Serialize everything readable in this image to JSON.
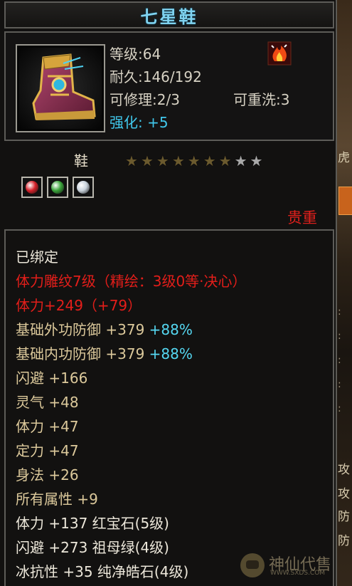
{
  "item": {
    "name": "七星鞋",
    "level": "等级:64",
    "durability": "耐久:146/192",
    "repair": "可修理:2/3",
    "rewash": "可重洗:3",
    "enhance_label": "强化:",
    "enhance_value": "+5",
    "type": "鞋",
    "quality": "贵重",
    "stars": {
      "filled": 7,
      "total": 9
    },
    "gems": [
      {
        "name": "ruby-gem",
        "color": "#d6212a"
      },
      {
        "name": "emerald-gem",
        "color": "#3aa33a"
      },
      {
        "name": "diamond-gem",
        "color": "#c9d3dc"
      }
    ]
  },
  "attributes": [
    {
      "text": "已绑定",
      "color": "white"
    },
    {
      "text": "体力雕纹7级（精绘：3级0等·决心）",
      "color": "red"
    },
    {
      "text": "体力+249（+79）",
      "color": "red"
    },
    {
      "text": "基础外功防御 +379 ",
      "pct": "+88%",
      "color": "yellow"
    },
    {
      "text": "基础内功防御 +379 ",
      "pct": "+88%",
      "color": "yellow"
    },
    {
      "text": "闪避 +166",
      "color": "yellow"
    },
    {
      "text": "灵气 +48",
      "color": "yellow"
    },
    {
      "text": "体力 +47",
      "color": "yellow"
    },
    {
      "text": "定力 +47",
      "color": "yellow"
    },
    {
      "text": "身法 +26",
      "color": "yellow"
    },
    {
      "text": "所有属性 +9",
      "color": "yellow"
    },
    {
      "text": "体力 +137 红宝石(5级)",
      "color": "white"
    },
    {
      "text": "闪避 +273 祖母绿(4级)",
      "color": "white"
    },
    {
      "text": "冰抗性 +35 纯净皓石(4级)",
      "color": "white"
    }
  ],
  "side_fragments": [
    "虎",
    "攻",
    "攻",
    "防",
    "防"
  ],
  "watermark": {
    "text": "神仙代售",
    "url": "WWW.SXDS.COM"
  },
  "colors": {
    "title": "#7fd3f0",
    "red": "#e31e1a",
    "yellow": "#dcc99b",
    "cyan": "#55d8f2",
    "quality": "#e0201c"
  }
}
